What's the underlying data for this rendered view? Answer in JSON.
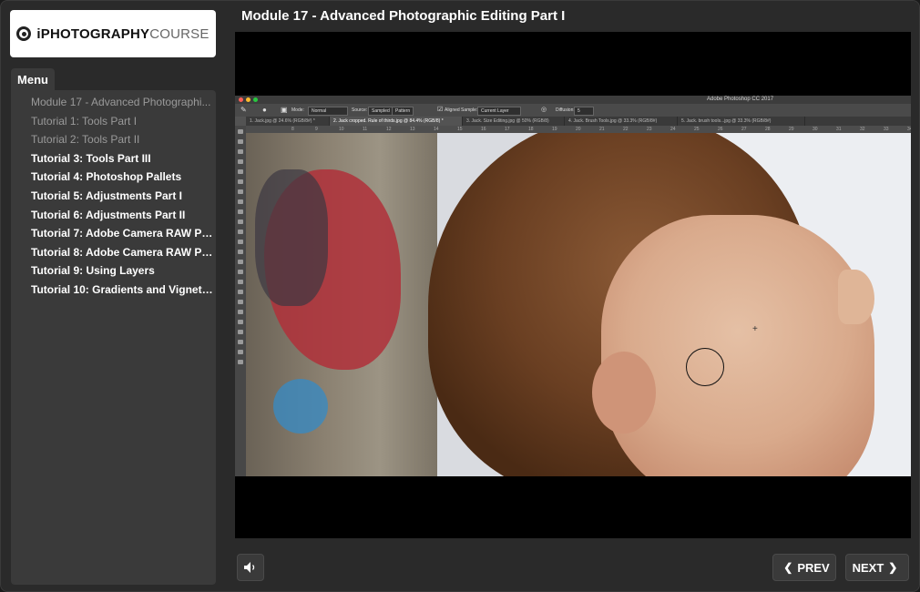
{
  "logo": {
    "bold": "iPHOTOGRAPHY",
    "light": "COURSE"
  },
  "sidebar": {
    "tab_label": "Menu",
    "items": [
      {
        "label": "Module 17 - Advanced Photographi...",
        "visited": true
      },
      {
        "label": "Tutorial 1: Tools Part I",
        "visited": true
      },
      {
        "label": "Tutorial 2: Tools Part II",
        "visited": true
      },
      {
        "label": "Tutorial 3: Tools Part III",
        "visited": false
      },
      {
        "label": "Tutorial 4: Photoshop Pallets",
        "visited": false
      },
      {
        "label": "Tutorial 5: Adjustments Part I",
        "visited": false
      },
      {
        "label": "Tutorial 6: Adjustments Part II",
        "visited": false
      },
      {
        "label": "Tutorial 7: Adobe Camera RAW Part I",
        "visited": false
      },
      {
        "label": "Tutorial 8: Adobe Camera RAW Part II",
        "visited": false
      },
      {
        "label": "Tutorial 9: Using Layers",
        "visited": false
      },
      {
        "label": "Tutorial 10: Gradients and Vignettes",
        "visited": false
      }
    ]
  },
  "header": {
    "title": "Module 17 - Advanced Photographic Editing Part I"
  },
  "photoshop": {
    "app_title": "Adobe Photoshop CC 2017",
    "options": {
      "mode_label": "Mode:",
      "mode_value": "Normal",
      "source_label": "Source:",
      "source_sampled": "Sampled",
      "source_pattern": "Pattern",
      "aligned_label": "Aligned",
      "sample_label": "Sample:",
      "sample_value": "Current Layer",
      "diffusion_label": "Diffusion:",
      "diffusion_value": "5"
    },
    "tabs": [
      "1. Jack.jpg @ 24.6% (RGB/8#) *",
      "2. Jack cropped. Rule of thirds.jpg @ 84.4% (RGB/8) *",
      "3. Jack. Size Editing.jpg @ 50% (RGB/8)",
      "4. Jack. Brush Tools.jpg @ 33.3% (RGB/8#)",
      "5. Jack. brush tools...jpg @ 33.3% (RGB/8#)"
    ],
    "ruler_ticks": [
      "8",
      "9",
      "10",
      "11",
      "12",
      "13",
      "14",
      "15",
      "16",
      "17",
      "18",
      "19",
      "20",
      "21",
      "22",
      "23",
      "24",
      "25",
      "26",
      "27",
      "28",
      "29",
      "30",
      "31",
      "32",
      "33",
      "34"
    ]
  },
  "controls": {
    "prev_label": "PREV",
    "next_label": "NEXT"
  },
  "colors": {
    "accent_red": "#c0262d",
    "bg": "#2a2a2a",
    "panel": "#3a3a3a"
  }
}
